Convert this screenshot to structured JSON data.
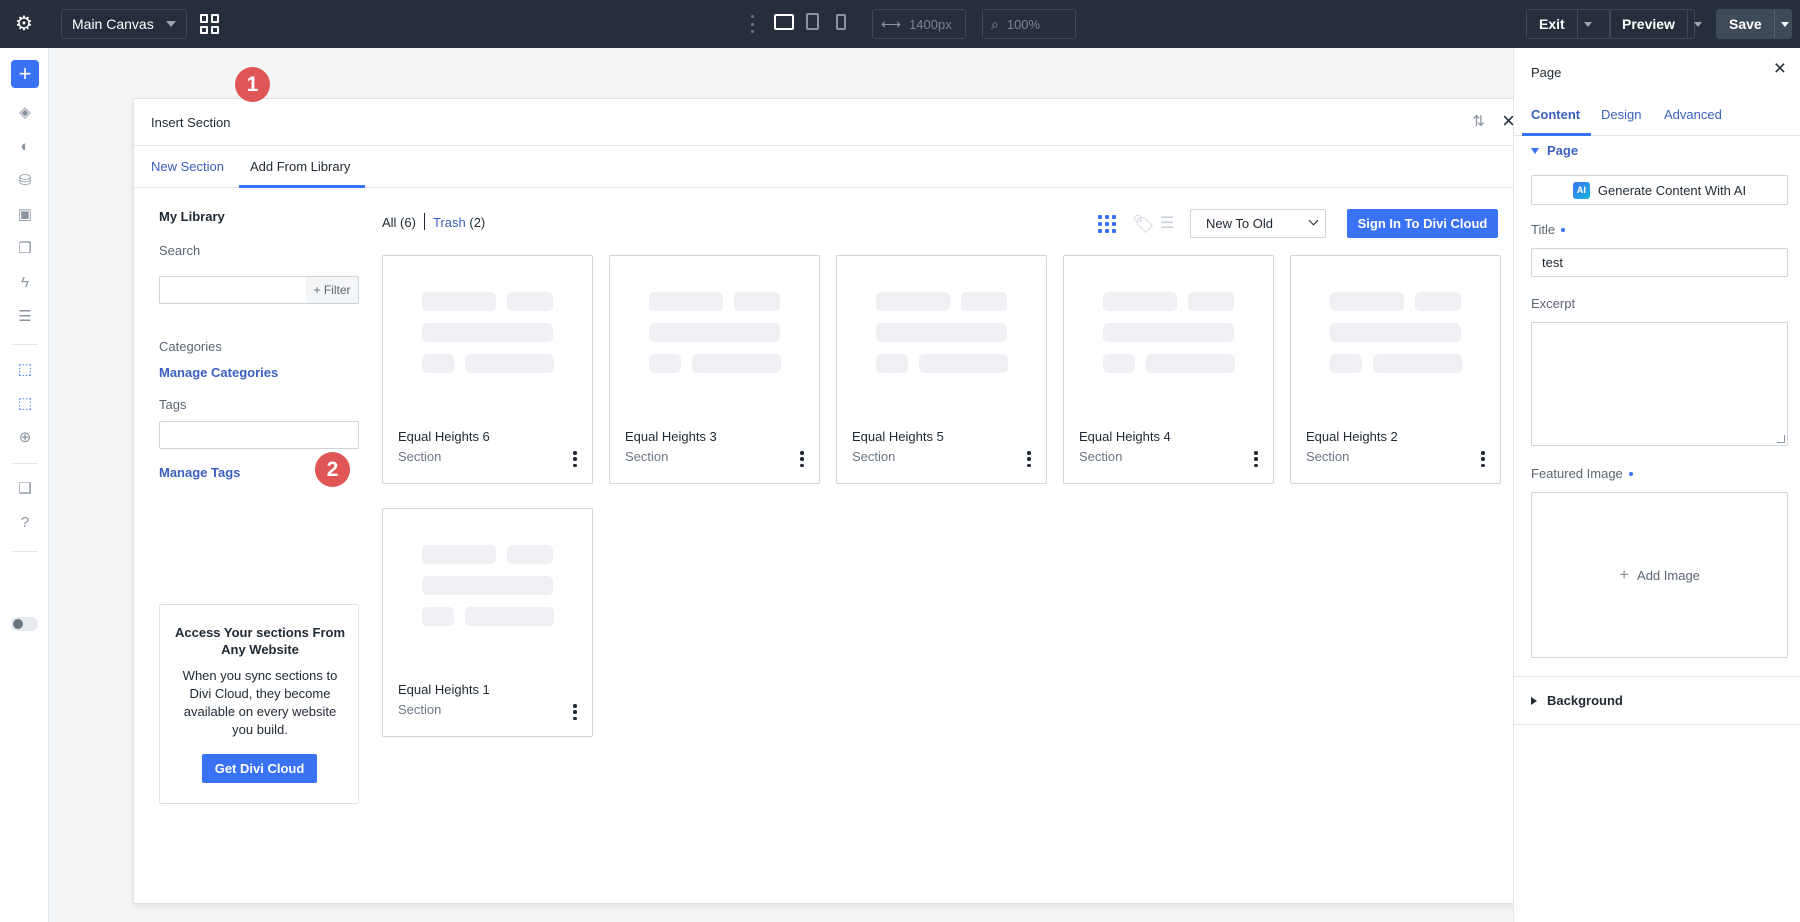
{
  "topbar": {
    "canvas_select": "Main Canvas",
    "width_value": "1400px",
    "zoom_value": "100%",
    "exit_label": "Exit",
    "preview_label": "Preview",
    "save_label": "Save",
    "icons": [
      "gear-icon",
      "grid-icon",
      "more-icon",
      "desktop-icon",
      "tablet-icon",
      "phone-icon",
      "width-icon",
      "zoom-icon"
    ]
  },
  "leftbar": {
    "icons": [
      "add-icon",
      "layers-icon",
      "theme-icon",
      "database-icon",
      "portability-icon",
      "pages-icon",
      "lightning-icon",
      "history-icon",
      "insert-section-icon",
      "library-section-icon",
      "global-icon",
      "canvases-icon",
      "help-icon",
      "toggle-icon"
    ]
  },
  "modal": {
    "title": "Insert Section",
    "tabs": [
      "New Section",
      "Add From Library"
    ],
    "active_tab": "Add From Library"
  },
  "library": {
    "title": "My Library",
    "search_label": "Search",
    "filter_label": "+ Filter",
    "categories_label": "Categories",
    "manage_categories": "Manage Categories",
    "tags_label": "Tags",
    "manage_tags": "Manage Tags",
    "cloud": {
      "heading": "Access Your sections From Any Website",
      "text": "When you sync sections to Divi Cloud, they become available on every website you build.",
      "button": "Get Divi Cloud"
    },
    "filter_all": "All (6)",
    "filter_trash": "Trash",
    "filter_trash_count": "(2)",
    "sort_select": "New To Old",
    "signin_button": "Sign In To Divi Cloud",
    "items": [
      {
        "name": "Equal Heights 6",
        "type": "Section"
      },
      {
        "name": "Equal Heights 3",
        "type": "Section"
      },
      {
        "name": "Equal Heights 5",
        "type": "Section"
      },
      {
        "name": "Equal Heights 4",
        "type": "Section"
      },
      {
        "name": "Equal Heights 2",
        "type": "Section"
      },
      {
        "name": "Equal Heights 1",
        "type": "Section"
      }
    ]
  },
  "badges": [
    "1",
    "2"
  ],
  "badge_color": "#e05656",
  "accent_color": "#3a72f5",
  "right_panel": {
    "title": "Page",
    "tabs": [
      "Content",
      "Design",
      "Advanced"
    ],
    "active_tab": "Content",
    "section_page": "Page",
    "ai_button": "Generate Content With AI",
    "ai_logo": "AI",
    "title_label": "Title",
    "title_value": "test",
    "excerpt_label": "Excerpt",
    "featured_label": "Featured Image",
    "add_image": "Add Image",
    "section_background": "Background"
  }
}
